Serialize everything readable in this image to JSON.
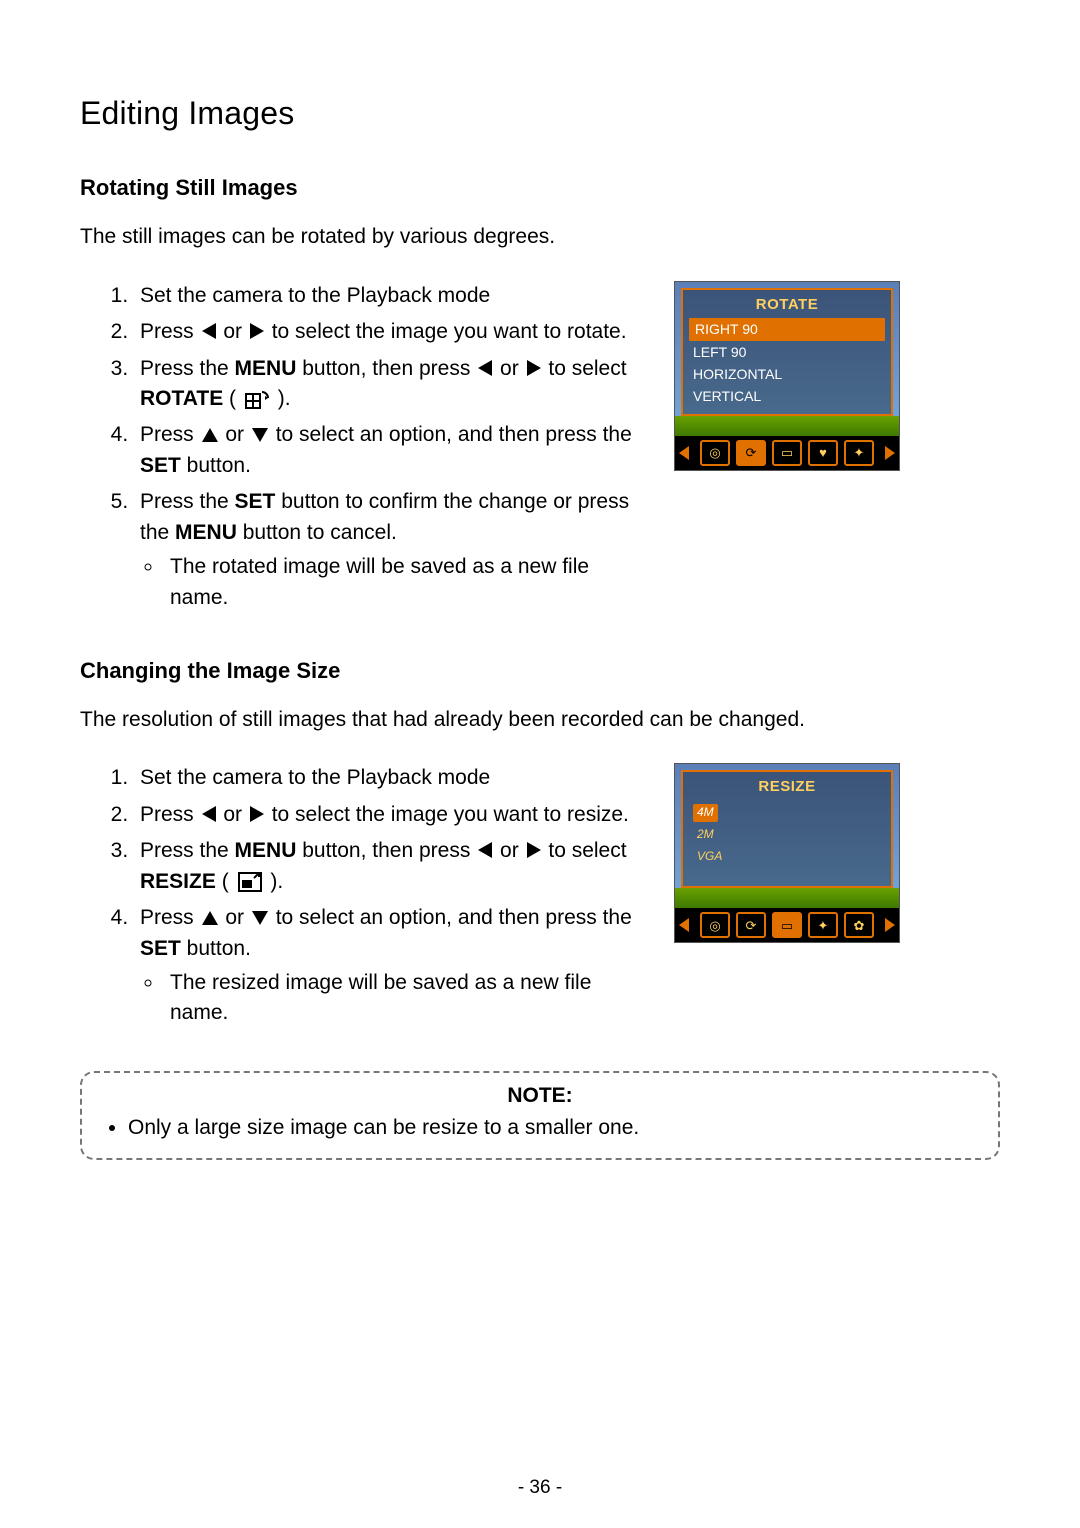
{
  "page": {
    "title": "Editing Images",
    "page_number": "- 36 -"
  },
  "section_rotate": {
    "heading": "Rotating Still Images",
    "intro": "The still images can be rotated by various degrees.",
    "steps": {
      "s1": "Set the camera to the Playback mode",
      "s2a": "Press ",
      "s2b": " or ",
      "s2c": " to select the image you want to rotate.",
      "s3a": "Press the ",
      "s3_menu": "MENU",
      "s3b": " button, then press ",
      "s3c": " or ",
      "s3d": " to select ",
      "s3_rotate": "ROTATE",
      "s3e": " ( ",
      "s3f": " ).",
      "s4a": "Press ",
      "s4b": " or ",
      "s4c": " to select an option, and then press the ",
      "s4_set": "SET",
      "s4d": " button.",
      "s5a": "Press the ",
      "s5_set": "SET",
      "s5b": " button to confirm the change or press the ",
      "s5_menu": "MENU",
      "s5c": " button to cancel.",
      "bullet": "The rotated image will be saved as a new file name."
    },
    "lcd": {
      "menu_title": "ROTATE",
      "items": [
        "RIGHT 90",
        "LEFT 90",
        "HORIZONTAL",
        "VERTICAL"
      ],
      "selected_index": 0,
      "toolbar_active_index": 1
    }
  },
  "section_resize": {
    "heading": "Changing the Image Size",
    "intro": "The resolution of still images that had already been recorded can be changed.",
    "steps": {
      "s1": "Set the camera to the Playback mode",
      "s2a": "Press ",
      "s2b": " or ",
      "s2c": " to select the image you want to resize.",
      "s3a": "Press the ",
      "s3_menu": "MENU",
      "s3b": " button, then press ",
      "s3c": " or ",
      "s3d": " to select ",
      "s3_resize": "RESIZE",
      "s3e": " ( ",
      "s3f": " ).",
      "s4a": "Press ",
      "s4b": " or ",
      "s4c": " to select an option, and then press the ",
      "s4_set": "SET",
      "s4d": " button.",
      "bullet": "The resized image will be saved as a new file name."
    },
    "lcd": {
      "menu_title": "RESIZE",
      "items": [
        "4M",
        "2M",
        "VGA"
      ],
      "selected_index": 0,
      "toolbar_active_index": 2
    }
  },
  "note": {
    "title": "NOTE:",
    "bullet": "Only a large size image can be resize to a smaller one."
  }
}
